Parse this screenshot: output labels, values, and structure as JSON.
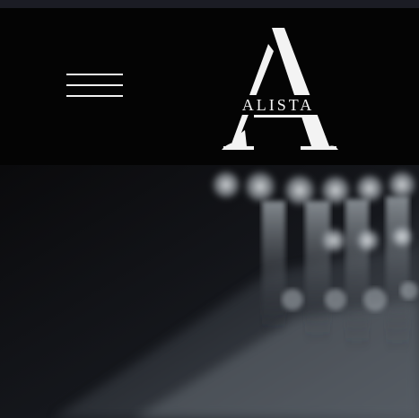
{
  "header": {
    "menu_icon": "hamburger-menu-icon",
    "logo": {
      "letter": "A",
      "wordmark": "ALISTA"
    }
  },
  "hero": {
    "image_subject": "blurred-bokeh-clothing-hangers"
  },
  "colors": {
    "header_bg": "#040404",
    "top_strip": "#1b1c24",
    "logo_fg": "#f3f3f3",
    "hero_bg": "#0b0b0d"
  }
}
